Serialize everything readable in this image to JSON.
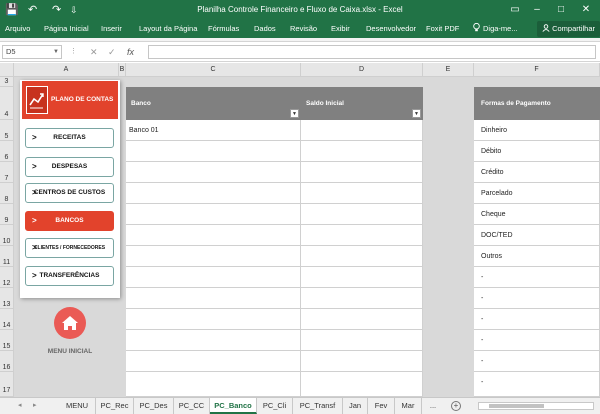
{
  "window": {
    "title": "Planilha Controle Financeiro e Fluxo de Caixa.xlsx  -  Excel",
    "quick_access": {
      "save": "💾",
      "undo": "↶",
      "redo": "↷",
      "customize": "⇩"
    },
    "controls": {
      "options": "▭",
      "minimize": "–",
      "maximize": "□",
      "close": "✕"
    }
  },
  "ribbon": {
    "tabs": [
      "Arquivo",
      "Página Inicial",
      "Inserir",
      "Layout da Página",
      "Fórmulas",
      "Dados",
      "Revisão",
      "Exibir",
      "Desenvolvedor",
      "Foxit PDF",
      "Diga-me..."
    ],
    "tell_me_icon": "lightbulb-icon",
    "share": "Compartilhar",
    "share_icon": "person-icon"
  },
  "formula_bar": {
    "name_box": "D5",
    "cancel": "✕",
    "enter": "✓",
    "fx": "fx",
    "content": ""
  },
  "columns": [
    "A",
    "B",
    "C",
    "D",
    "E",
    "F"
  ],
  "rows": [
    "3",
    "4",
    "5",
    "6",
    "7",
    "8",
    "9",
    "10",
    "11",
    "12",
    "13",
    "14",
    "15",
    "16",
    "17"
  ],
  "table": {
    "headers": [
      "Banco",
      "Saldo Inicial",
      "Formas de Pagamento"
    ],
    "banco": [
      "Banco 01",
      "",
      "",
      "",
      "",
      "",
      "",
      "",
      "",
      "",
      "",
      "",
      ""
    ],
    "saldo": [
      "",
      "",
      "",
      "",
      "",
      "",
      "",
      "",
      "",
      "",
      "",
      "",
      ""
    ],
    "formas": [
      "Dinheiro",
      "Débito",
      "Crédito",
      "Parcelado",
      "Cheque",
      "DOC/TED",
      "Outros",
      "-",
      "-",
      "-",
      "-",
      "-",
      "-"
    ]
  },
  "menu": {
    "header": "PLANO DE CONTAS",
    "header_icon": "chart-icon",
    "buttons": [
      "RECEITAS",
      "DESPESAS",
      "CENTROS DE CUSTOS",
      "BANCOS",
      "CLIENTES / FORNECEDORES",
      "TRANSFERÊNCIAS"
    ],
    "chevron": ">",
    "active": "BANCOS",
    "home_icon": "home-icon",
    "home_label": "MENU INICIAL"
  },
  "colors": {
    "excel_green": "#217346",
    "menu_red": "#e2432c",
    "header_gray": "#808080"
  },
  "sheets": {
    "tabs": [
      "MENU",
      "PC_Rec",
      "PC_Des",
      "PC_CC",
      "PC_Banco",
      "PC_Cli",
      "PC_Transf",
      "Jan",
      "Fev",
      "Mar"
    ],
    "active": "PC_Banco",
    "more": "...",
    "add": "+",
    "nav_prev": "◂",
    "nav_next": "▸"
  }
}
